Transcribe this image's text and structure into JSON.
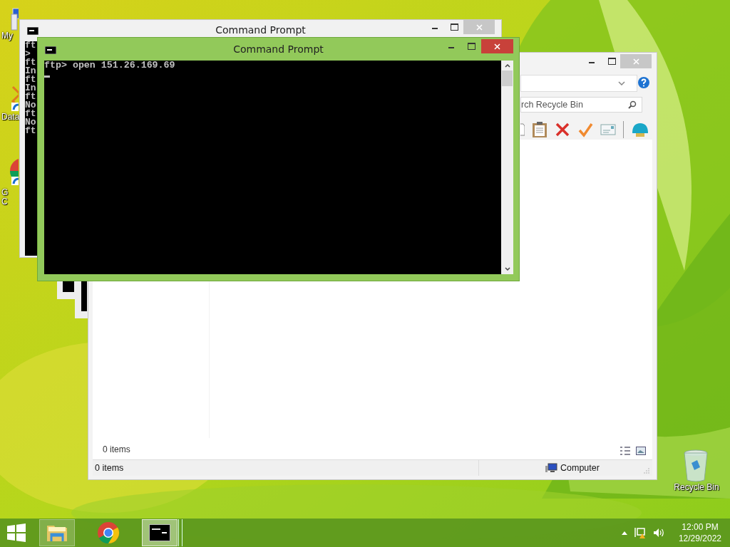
{
  "desktop_icons": [
    {
      "kind": "computer",
      "lines": [
        "My"
      ]
    },
    {
      "kind": "shortcut",
      "lines": [
        "Data"
      ]
    },
    {
      "kind": "browser",
      "lines": [
        "G",
        "C"
      ]
    },
    {
      "kind": "recycle",
      "lines": [
        "Recycle Bin"
      ]
    }
  ],
  "back_console": {
    "title": "Command Prompt",
    "lines": [
      "ft",
      ">",
      "ft",
      "In",
      "ft",
      "In",
      "ft",
      "No",
      "ft",
      "No",
      "ft"
    ]
  },
  "explorer": {
    "search": {
      "placeholder": "rch Recycle Bin"
    },
    "content_status": "0 items",
    "status_bar": {
      "count": "0 items",
      "location": "Computer"
    }
  },
  "front_console": {
    "title": "Command Prompt",
    "lines": [
      "ftp> open 151.26.169.69"
    ],
    "cursor": true
  },
  "taskbar": {
    "apps": [
      {
        "kind": "explorer",
        "selected": false
      },
      {
        "kind": "browser",
        "selected": false
      },
      {
        "kind": "console",
        "selected": true
      }
    ],
    "time": "12:00 PM",
    "date": "12/29/2022"
  }
}
